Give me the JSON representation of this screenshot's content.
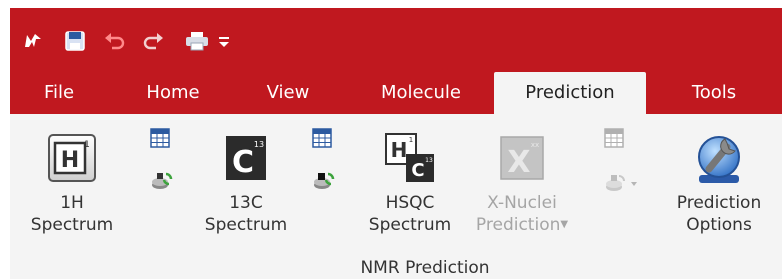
{
  "title_bar": {
    "quick_access": {
      "app_icon": "app-logo-icon",
      "save": "save-icon",
      "undo": "undo-icon",
      "redo": "redo-icon",
      "print": "print-icon",
      "customize": "customize-quick-access-icon"
    }
  },
  "tabs": [
    {
      "label": "File"
    },
    {
      "label": "Home"
    },
    {
      "label": "View"
    },
    {
      "label": "Molecule"
    },
    {
      "label": "Prediction",
      "active": true
    },
    {
      "label": "Tools"
    }
  ],
  "ribbon": {
    "group_label": "NMR Prediction",
    "buttons": {
      "h1": {
        "line1": "1H",
        "line2": "Spectrum",
        "icon": "h1-spectrum-icon"
      },
      "c13": {
        "line1": "13C",
        "line2": "Spectrum",
        "icon": "c13-spectrum-icon"
      },
      "hsqc": {
        "line1": "HSQC",
        "line2": "Spectrum",
        "icon": "hsqc-spectrum-icon"
      },
      "xnuclei": {
        "line1": "X-Nuclei",
        "line2": "Prediction",
        "icon": "x-nuclei-icon",
        "enabled": false
      },
      "options": {
        "line1": "Prediction",
        "line2": "Options",
        "icon": "prediction-options-icon"
      }
    }
  },
  "colors": {
    "title_bar": "#c0181f",
    "ribbon_bg": "#f4f4f4",
    "disabled_text": "#a5a5a5"
  }
}
